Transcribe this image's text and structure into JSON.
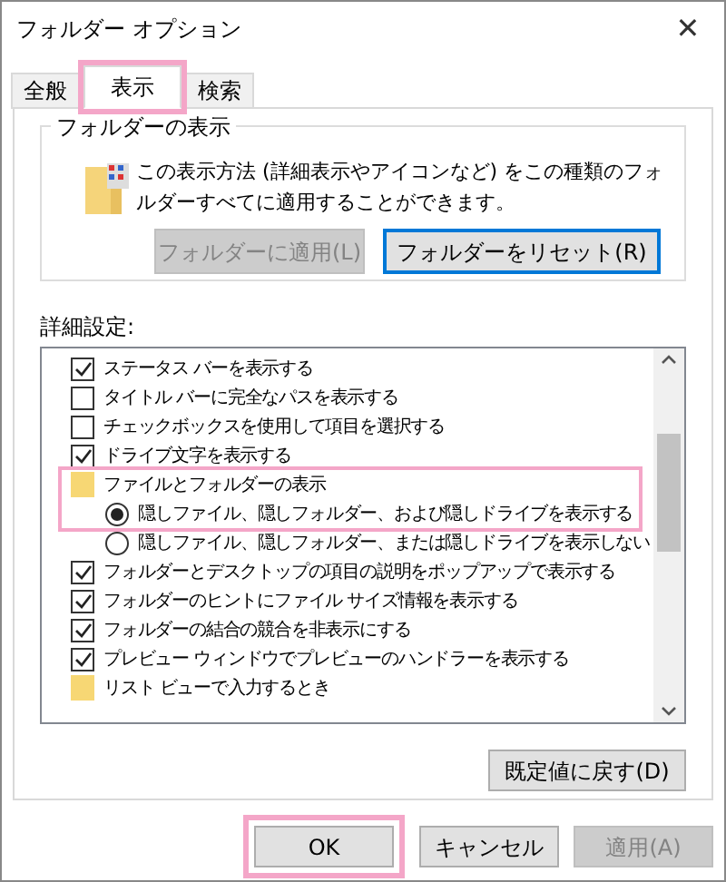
{
  "window": {
    "title": "フォルダー オプション",
    "close": "✕"
  },
  "tabs": [
    {
      "label": "全般",
      "selected": false,
      "highlighted": false
    },
    {
      "label": "表示",
      "selected": true,
      "highlighted": true
    },
    {
      "label": "検索",
      "selected": false,
      "highlighted": false
    }
  ],
  "folder_view": {
    "title": "フォルダーの表示",
    "description": "この表示方法 (詳細表示やアイコンなど) をこの種類のフォルダーすべてに適用することができます。",
    "buttons": [
      {
        "label": "フォルダーに適用(L)",
        "disabled": true
      },
      {
        "label": "フォルダーをリセット(R)",
        "disabled": false
      }
    ]
  },
  "advanced": {
    "label": "詳細設定:",
    "items": [
      {
        "kind": "check",
        "label": "ステータス バーを表示する",
        "checked": true
      },
      {
        "kind": "check",
        "label": "タイトル バーに完全なパスを表示する",
        "checked": false
      },
      {
        "kind": "check",
        "label": "チェックボックスを使用して項目を選択する",
        "checked": false
      },
      {
        "kind": "check",
        "label": "ドライブ文字を表示する",
        "checked": true
      },
      {
        "kind": "folder",
        "label": "ファイルとフォルダーの表示",
        "highlighted": true,
        "children": [
          {
            "kind": "radio",
            "label": "隠しファイル、隠しフォルダー、および隠しドライブを表示する",
            "selected": true
          },
          {
            "kind": "radio",
            "label": "隠しファイル、隠しフォルダー、または隠しドライブを表示しない",
            "selected": false
          }
        ]
      },
      {
        "kind": "check",
        "label": "フォルダーとデスクトップの項目の説明をポップアップで表示する",
        "checked": true
      },
      {
        "kind": "check",
        "label": "フォルダーのヒントにファイル サイズ情報を表示する",
        "checked": true
      },
      {
        "kind": "check",
        "label": "フォルダーの結合の競合を非表示にする",
        "checked": true
      },
      {
        "kind": "check",
        "label": "プレビュー ウィンドウでプレビューのハンドラーを表示する",
        "checked": true
      },
      {
        "kind": "folder",
        "label": "リスト ビューで入力するとき",
        "highlighted": false
      }
    ]
  },
  "restore_button": {
    "label": "既定値に戻す(D)"
  },
  "buttons": [
    {
      "label": "OK",
      "disabled": false,
      "highlighted": true
    },
    {
      "label": "キャンセル",
      "disabled": false,
      "highlighted": false
    },
    {
      "label": "適用(A)",
      "disabled": true,
      "highlighted": false
    }
  ]
}
